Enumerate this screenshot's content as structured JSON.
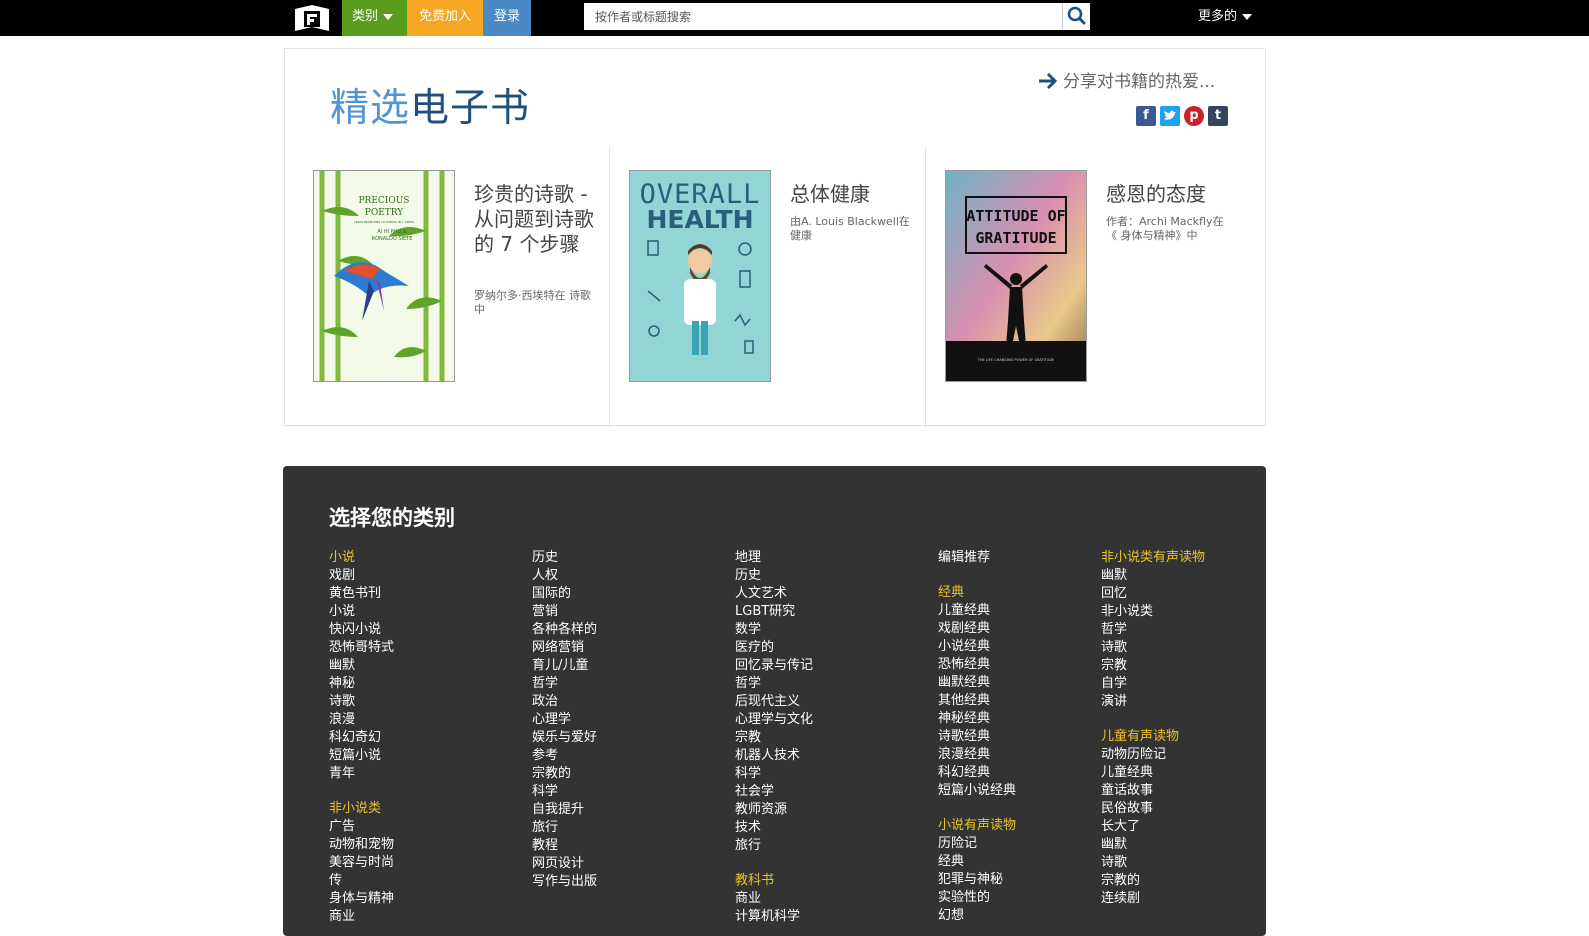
{
  "nav": {
    "categories_label": "类别",
    "join_label": "免费加入",
    "login_label": "登录",
    "search_placeholder": "按作者或标题搜索",
    "more_label": "更多的"
  },
  "featured": {
    "title_part1": "精选",
    "title_part2": "电子书",
    "share_label": "分享对书籍的热爱...",
    "books": [
      {
        "title": "珍贵的诗歌 - 从问题到诗歌的 7 个步骤",
        "meta": "罗纳尔多·西埃特在 诗歌中",
        "cover_lines": [
          "PRECIOUS",
          "POETRY"
        ],
        "cover_sub": "FROM PROBLEMS TO POEMS IN 7 STEPS",
        "cover_authors": [
          "AI HI PHU &",
          "RONALDO SIETE"
        ]
      },
      {
        "title": "总体健康",
        "meta": "由A. Louis Blackwell在 健康",
        "cover_lines": [
          "OVERALL",
          "HEALTH"
        ]
      },
      {
        "title": "感恩的态度",
        "meta": "作者：Archi Mackfly在 《 身体与精神》中",
        "cover_lines": [
          "ATTITUDE OF",
          "GRATITUDE"
        ],
        "cover_sub": "THE LIFE CHANGING POWER OF GRATITUDE"
      }
    ]
  },
  "categories": {
    "heading": "选择您的类别",
    "col1": {
      "h1": "小说",
      "list1": [
        "戏剧",
        "黄色书刊",
        "小说",
        "快闪小说",
        "恐怖哥特式",
        "幽默",
        "神秘",
        "诗歌",
        "浪漫",
        "科幻奇幻",
        "短篇小说",
        "青年"
      ],
      "h2": "非小说类",
      "list2": [
        "广告",
        "动物和宠物",
        "美容与时尚",
        "传",
        "身体与精神",
        "商业"
      ]
    },
    "col2": {
      "list1": [
        "历史",
        "人权",
        "国际的",
        "营销",
        "各种各样的",
        "网络营销",
        "育儿/儿童",
        "哲学",
        "政治",
        "心理学",
        "娱乐与爱好",
        "参考",
        "宗教的",
        "科学",
        "自我提升",
        "旅行",
        "教程",
        "网页设计",
        "写作与出版"
      ]
    },
    "col3": {
      "list1": [
        "地理",
        "历史",
        "人文艺术",
        "LGBT研究",
        "数学",
        "医疗的",
        "回忆录与传记",
        "哲学",
        "后现代主义",
        "心理学与文化",
        "宗教",
        "机器人技术",
        "科学",
        "社会学",
        "教师资源",
        "技术",
        "旅行"
      ],
      "h2": "教科书",
      "list2": [
        "商业",
        "计算机科学"
      ]
    },
    "col4": {
      "list0": [
        "编辑推荐"
      ],
      "h1": "经典",
      "list1": [
        "儿童经典",
        "戏剧经典",
        "小说经典",
        "恐怖经典",
        "幽默经典",
        "其他经典",
        "神秘经典",
        "诗歌经典",
        "浪漫经典",
        "科幻经典",
        "短篇小说经典"
      ],
      "h2": "小说有声读物",
      "list2": [
        "历险记",
        "经典",
        "犯罪与神秘",
        "实验性的",
        "幻想"
      ]
    },
    "col5": {
      "h1": "非小说类有声读物",
      "list1": [
        "幽默",
        "回忆",
        "非小说类",
        "哲学",
        "诗歌",
        "宗教",
        "自学",
        "演讲"
      ],
      "h2": "儿童有声读物",
      "list2": [
        "动物历险记",
        "儿童经典",
        "童话故事",
        "民俗故事",
        "长大了",
        "幽默",
        "诗歌",
        "宗教的",
        "连续剧"
      ]
    }
  },
  "colors": {
    "nav_categories": "#5a9c1e",
    "nav_join": "#f5a623",
    "nav_login": "#4a8ac4",
    "category_heading": "#e8c32a",
    "panel_bg": "#333333",
    "title_light": "#4f95d6",
    "title_dark": "#1f4f7a"
  },
  "icons": [
    "book-logo-icon",
    "search-icon",
    "caret-down-icon",
    "arrow-right-icon",
    "facebook-icon",
    "twitter-icon",
    "pinterest-icon",
    "tumblr-icon"
  ]
}
